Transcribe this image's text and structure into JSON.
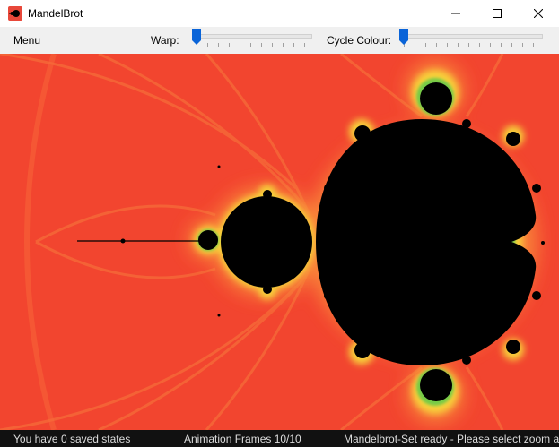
{
  "window": {
    "title": "MandelBrot",
    "app_icon": "mandelbrot-app-icon"
  },
  "toolbar": {
    "menu_label": "Menu",
    "warp_label": "Warp:",
    "warp_value": 0,
    "cycle_label": "Cycle Colour:",
    "cycle_value": 0
  },
  "status": {
    "saved_states": "You have 0 saved states",
    "animation_frames": "Animation Frames 10/10",
    "ready_message": "Mandelbrot-Set ready - Please select zoom area"
  },
  "colors": {
    "fractal_background": "#f2452f",
    "fractal_set": "#000000",
    "fractal_glow": "#f7d23a",
    "slider_thumb": "#0a64d8",
    "statusbar": "#111111"
  }
}
